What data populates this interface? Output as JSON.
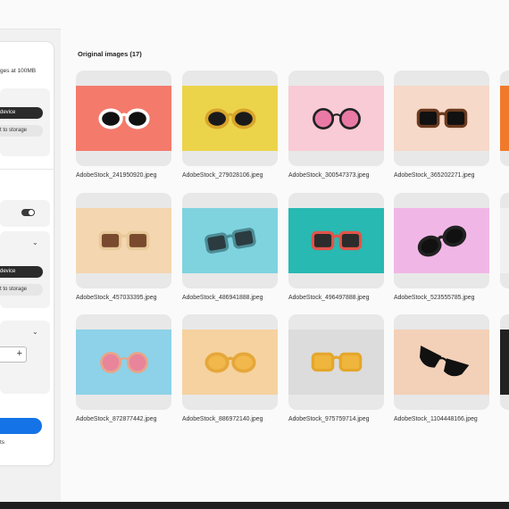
{
  "panel": {
    "size_note": "ges at 100MB",
    "group1": {
      "device_label": "device",
      "storage_label": "t to storage"
    },
    "group2": {
      "device_label": "device",
      "storage_label": "t to storage"
    },
    "footer_text": "ts"
  },
  "main": {
    "title": "Original images (17)",
    "images": [
      {
        "filename": "AdobeStock_241950920.jpeg",
        "bg": "#f47a6c",
        "frame": "#ffffff",
        "lens": "#111111",
        "shape": "round",
        "angle": 0
      },
      {
        "filename": "AdobeStock_279028106.jpeg",
        "bg": "#ecd44a",
        "frame": "#d8a52c",
        "lens": "#1a1a1a",
        "shape": "round",
        "angle": 0
      },
      {
        "filename": "AdobeStock_300547373.jpeg",
        "bg": "#f8cbd6",
        "frame": "#222222",
        "lens": "#e97aa5",
        "shape": "circle",
        "angle": 0
      },
      {
        "filename": "AdobeStock_365202271.jpeg",
        "bg": "#f6d9c9",
        "frame": "#6b3a1f",
        "lens": "#111111",
        "shape": "square",
        "angle": 0
      },
      {
        "filename": "AdobeStock_457033395.jpeg",
        "bg": "#f4d6b0",
        "frame": "#e8c99a",
        "lens": "#7a4a2e",
        "shape": "square",
        "angle": 0
      },
      {
        "filename": "AdobeStock_486941888.jpeg",
        "bg": "#7fd3df",
        "frame": "#4c8c96",
        "lens": "#2b3b3f",
        "shape": "square",
        "angle": -10
      },
      {
        "filename": "AdobeStock_496497888.jpeg",
        "bg": "#27b9b2",
        "frame": "#e1554a",
        "lens": "#2c2c2c",
        "shape": "square",
        "angle": 0
      },
      {
        "filename": "AdobeStock_523555785.jpeg",
        "bg": "#f0b7e6",
        "frame": "#222222",
        "lens": "#111111",
        "shape": "round",
        "angle": -22
      },
      {
        "filename": "AdobeStock_872877442.jpeg",
        "bg": "#8dd2e8",
        "frame": "#e7a68a",
        "lens": "#e8859b",
        "shape": "circle",
        "angle": 0
      },
      {
        "filename": "AdobeStock_886972140.jpeg",
        "bg": "#f5d29f",
        "frame": "#e6a73a",
        "lens": "#f2b84b",
        "shape": "round",
        "angle": 0
      },
      {
        "filename": "AdobeStock_975759714.jpeg",
        "bg": "#dcdcdc",
        "frame": "#e4a72c",
        "lens": "#f0b53c",
        "shape": "square",
        "angle": 0
      },
      {
        "filename": "AdobeStock_1104448166.jpeg",
        "bg": "#f3d1b8",
        "frame": "#111111",
        "lens": "#111111",
        "shape": "cat",
        "angle": 22
      }
    ],
    "partial_tile_colors": [
      "#f07a2a",
      "#f1f1f1",
      "#222222"
    ]
  }
}
